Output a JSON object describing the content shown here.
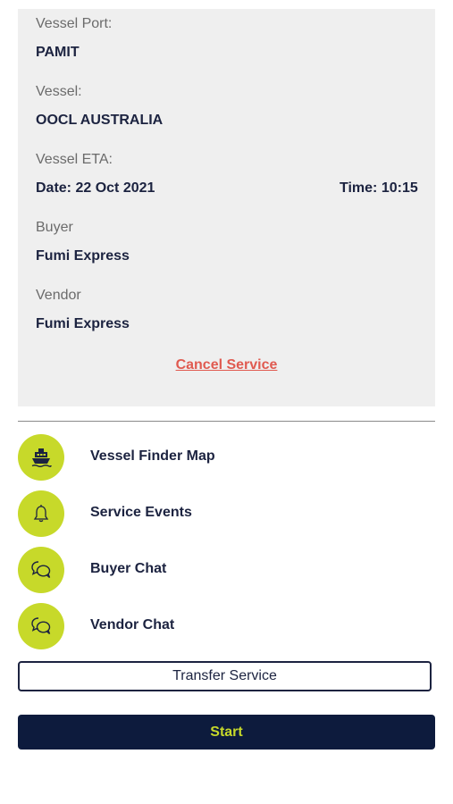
{
  "details": {
    "vessel_port_label": "Vessel Port:",
    "vessel_port_value": "PAMIT",
    "vessel_label": "Vessel:",
    "vessel_value": "OOCL AUSTRALIA",
    "eta_label": "Vessel ETA:",
    "eta_date": "Date:  22 Oct 2021",
    "eta_time": "Time:  10:15",
    "buyer_label": "Buyer",
    "buyer_value": "Fumi Express",
    "vendor_label": "Vendor",
    "vendor_value": "Fumi Express",
    "cancel_label": "Cancel Service"
  },
  "menu": [
    {
      "label": "Vessel Finder Map",
      "icon": "ship-icon"
    },
    {
      "label": "Service Events",
      "icon": "bell-icon"
    },
    {
      "label": "Buyer Chat",
      "icon": "chat-icon"
    },
    {
      "label": "Vendor Chat",
      "icon": "chat-icon"
    }
  ],
  "actions": {
    "transfer_label": "Transfer Service",
    "start_label": "Start"
  },
  "colors": {
    "accent": "#c7d92a",
    "navy": "#0d1b3d",
    "cancel": "#e05a50",
    "card_bg": "#efefef"
  }
}
